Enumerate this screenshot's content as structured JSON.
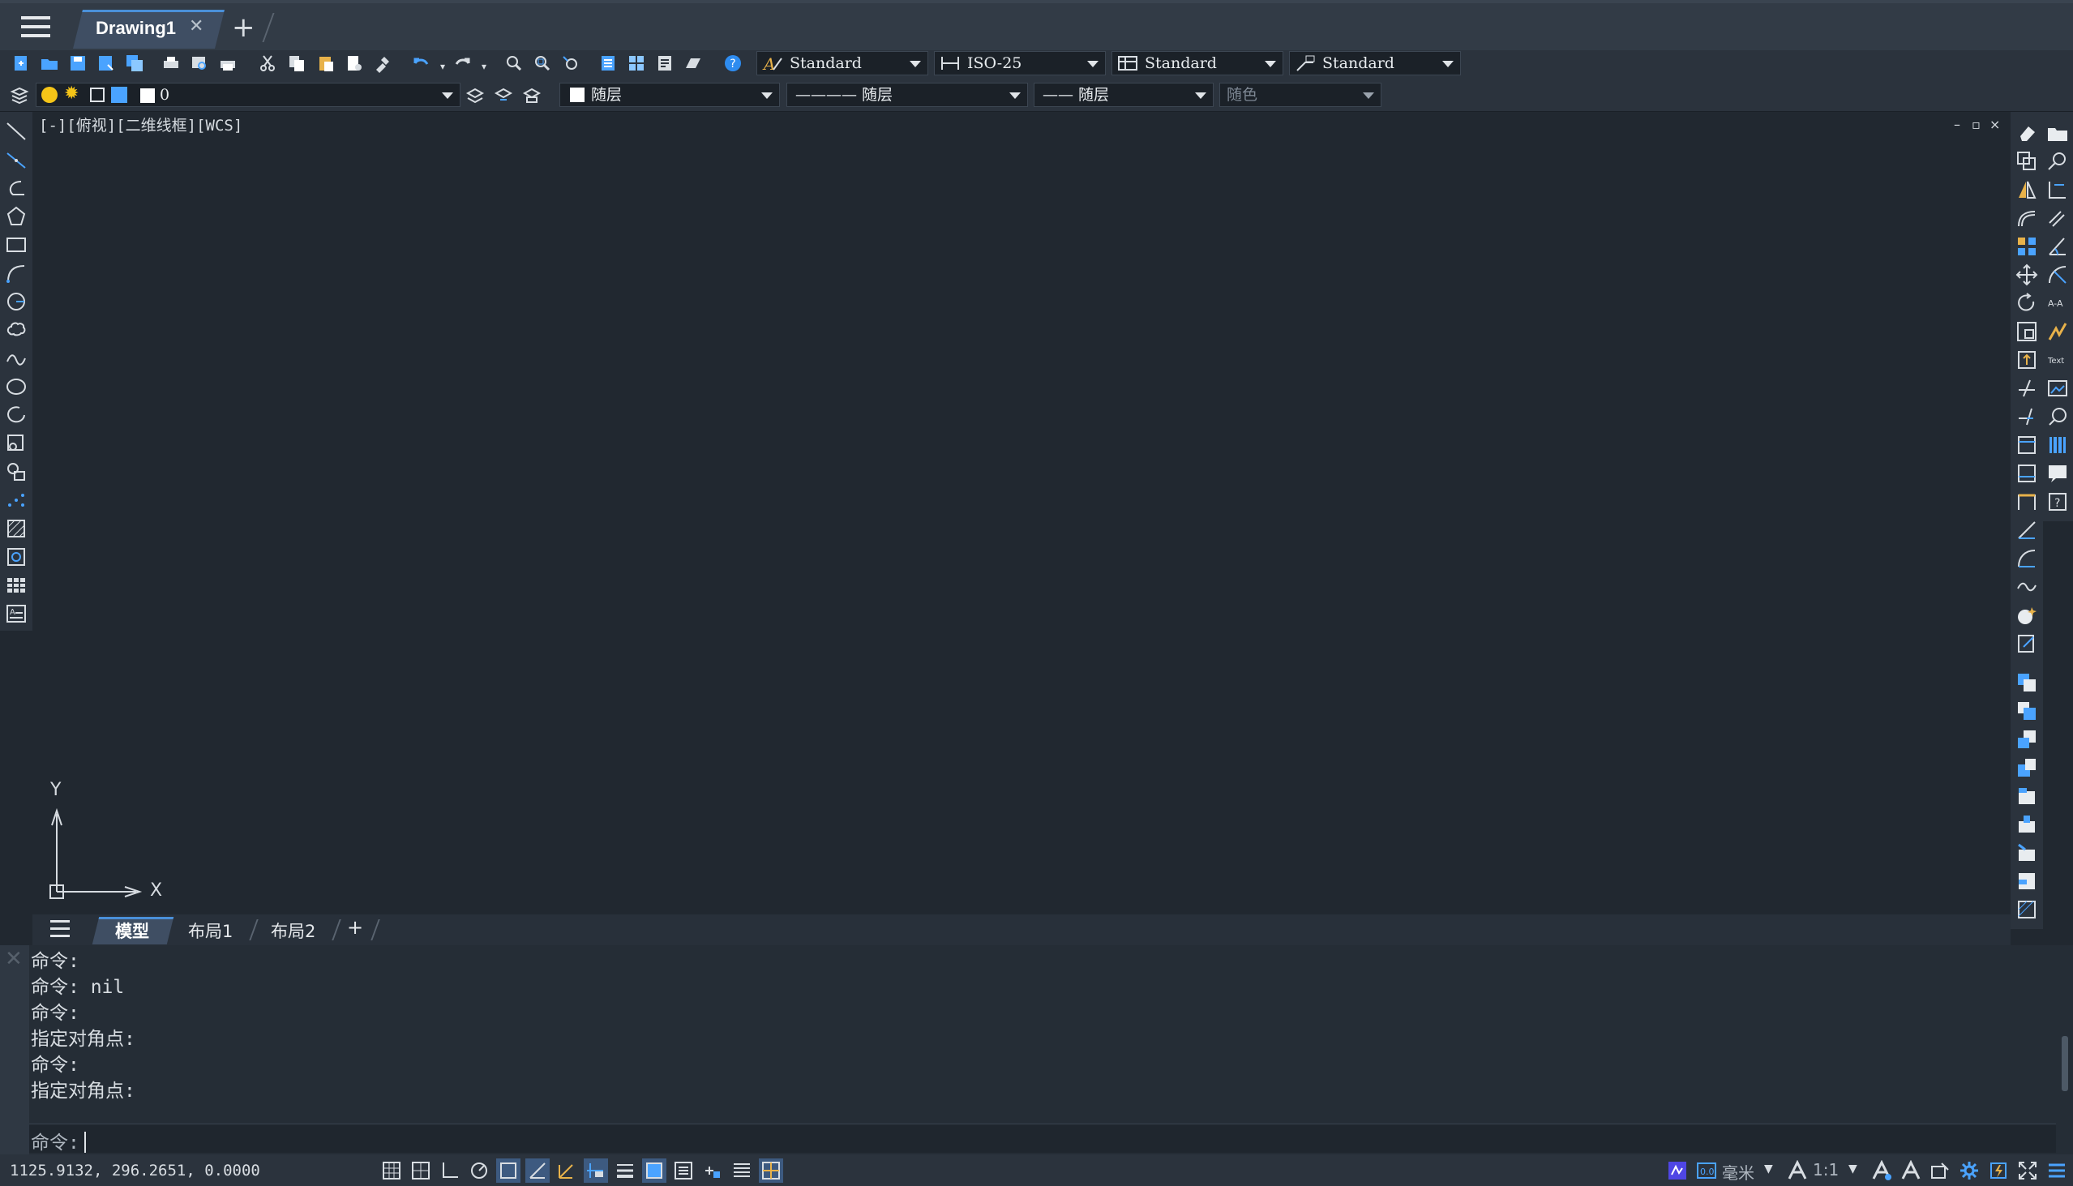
{
  "titlebar": {
    "doc_tab": "Drawing1",
    "close_glyph": "✕",
    "new_tab_glyph": "+"
  },
  "toolbar1": {
    "text_style": "Standard",
    "dim_style": "ISO-25",
    "table_style": "Standard",
    "multileader_style": "Standard"
  },
  "toolbar2": {
    "layer": "0",
    "color": "随层",
    "linetype": "———— 随层",
    "lineweight": "—— 随层",
    "plot_style": "随色"
  },
  "viewport": {
    "label": "[-][俯视][二维线框][WCS]",
    "minimize": "–",
    "restore": "▫",
    "close": "×",
    "ucs_x": "X",
    "ucs_y": "Y"
  },
  "layout_tabs": {
    "items": [
      "模型",
      "布局1",
      "布局2"
    ],
    "add": "+"
  },
  "command": {
    "history": [
      "命令:",
      "命令: nil",
      "命令:",
      "指定对角点:",
      "命令:",
      "指定对角点:"
    ],
    "prompt": "命令:"
  },
  "status": {
    "coordinates": "1125.9132, 296.2651, 0.0000",
    "units": "毫米",
    "scale": "1:1"
  },
  "colors": {
    "accent": "#4a90d9",
    "background": "#212830",
    "toolbar": "#2b333d"
  }
}
